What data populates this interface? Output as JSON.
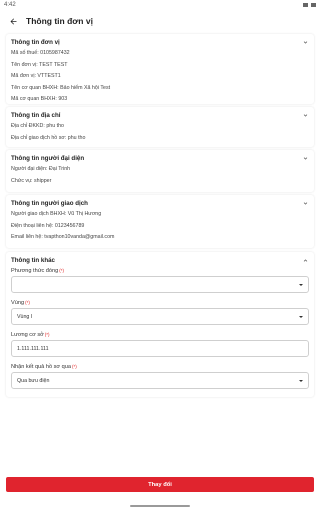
{
  "status": {
    "time": "4:42"
  },
  "header": {
    "title": "Thông tin đơn vị"
  },
  "sections": {
    "unit": {
      "title": "Thông tin đơn vị",
      "lines": [
        "Mã số thuế: 0105987432",
        "Tên đơn vị: TEST TEST",
        "Mã đơn vị: VTTEST1",
        "Tên cơ quan BHXH: Bảo hiểm Xã hội Test",
        "Mã cơ quan BHXH: 903"
      ]
    },
    "address": {
      "title": "Thông tin địa chỉ",
      "lines": [
        "Địa chỉ ĐKKD: phu tho",
        "Địa chỉ giao dịch hồ sơ: phu tho"
      ]
    },
    "representative": {
      "title": "Thông tin người đại diện",
      "lines": [
        "Người đại diện: Đại Trinh",
        "Chức vụ: shipper"
      ]
    },
    "contact": {
      "title": "Thông tin người giao dịch",
      "lines": [
        "Người giao dịch BHXH: Vũ Thị Hương",
        "Điện thoại liên hệ: 0123456789",
        "Email liên hệ: tvapthon10vanda@gmail.com"
      ]
    },
    "other": {
      "title": "Thông tin khác",
      "payment_label": "Phương thức đóng",
      "payment_value": "",
      "region_label": "Vùng",
      "region_value": "Vùng I",
      "salary_label": "Lương cơ sở",
      "salary_value": "1.111.111.111",
      "receive_label": "Nhận kết quả hồ sơ qua",
      "receive_value": "Qua bưu điện",
      "required_mark": "(*)"
    }
  },
  "footer": {
    "submit_label": "Thay đổi"
  },
  "colors": {
    "accent": "#e0242e"
  }
}
